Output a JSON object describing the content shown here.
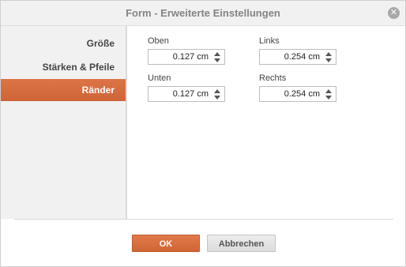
{
  "dialog": {
    "title": "Form - Erweiterte Einstellungen",
    "close_icon": "close-icon"
  },
  "sidebar": {
    "items": [
      {
        "label": "Größe",
        "active": false
      },
      {
        "label": "Stärken & Pfeile",
        "active": false
      },
      {
        "label": "Ränder",
        "active": true
      }
    ]
  },
  "margins": {
    "top": {
      "label": "Oben",
      "value": "0.127 cm"
    },
    "left": {
      "label": "Links",
      "value": "0.254 cm"
    },
    "bottom": {
      "label": "Unten",
      "value": "0.127 cm"
    },
    "right": {
      "label": "Rechts",
      "value": "0.254 cm"
    }
  },
  "footer": {
    "ok_label": "OK",
    "cancel_label": "Abbrechen"
  },
  "colors": {
    "accent": "#d46a3a",
    "titlebar_bg": "#f1f1f1"
  }
}
